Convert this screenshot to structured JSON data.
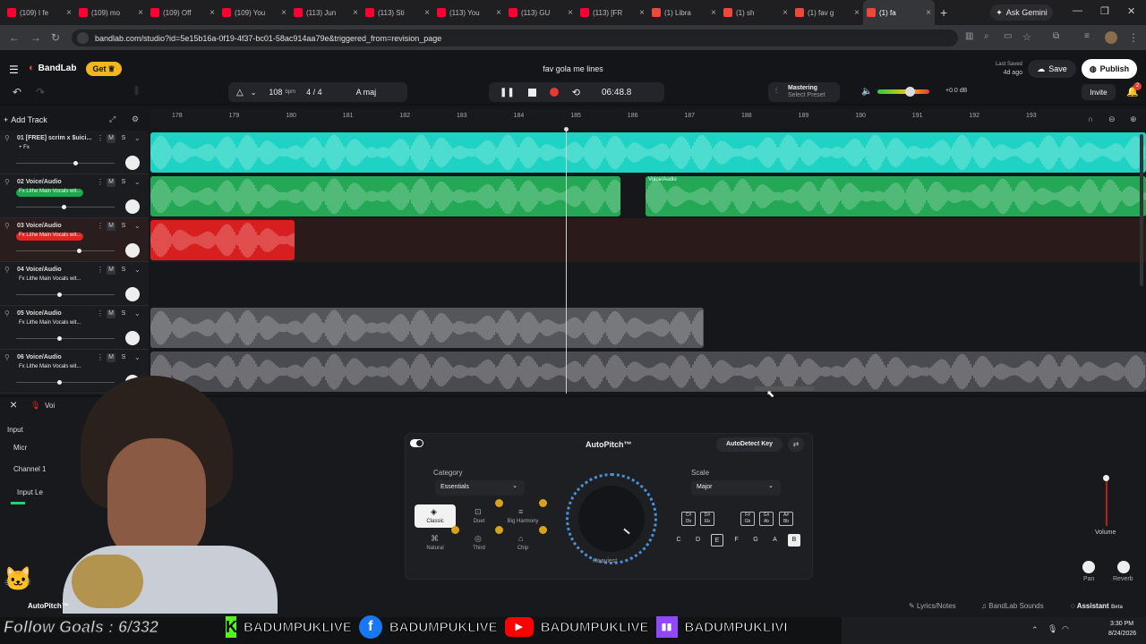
{
  "browser": {
    "tabs": [
      {
        "label": "(109) I fe",
        "color": "#ff0033"
      },
      {
        "label": "(109) mo",
        "color": "#ff0033"
      },
      {
        "label": "(109) Off",
        "color": "#ff0033"
      },
      {
        "label": "(109) You",
        "color": "#ff0033"
      },
      {
        "label": "(113) Jun",
        "color": "#ff0033"
      },
      {
        "label": "(113) Sti",
        "color": "#ff0033"
      },
      {
        "label": "(113) You",
        "color": "#ff0033"
      },
      {
        "label": "(113) GU",
        "color": "#ff0033"
      },
      {
        "label": "(113) [FR",
        "color": "#ff0033"
      },
      {
        "label": "(1) Libra",
        "color": "#f0473a"
      },
      {
        "label": "(1) sh",
        "color": "#f0473a"
      },
      {
        "label": "(1) fav g",
        "color": "#f0473a"
      },
      {
        "label": "(1) fa",
        "color": "#f0473a",
        "active": true
      }
    ],
    "new_tab": "+",
    "gemini_label": "Ask Gemini",
    "url": "bandlab.com/studio?id=5e15b16a-0f19-4f37-bc01-58ac914aa79e&triggered_from=revision_page"
  },
  "app": {
    "brand": "BandLab",
    "get_label": "Get",
    "project_title": "fav gola me lines",
    "last_saved_label": "Last Saved",
    "last_saved_value": "4d ago",
    "save_label": "Save",
    "publish_label": "Publish",
    "invite_label": "Invite",
    "notif_count": "2"
  },
  "toolbar": {
    "bpm_value": "108",
    "bpm_unit": "bpm",
    "time_sig": "4 / 4",
    "key": "A maj",
    "time": "06:48.8",
    "mastering_label": "Mastering",
    "mastering_preset": "Select Preset",
    "master_volume": "+0.0 dB",
    "master_volume_level": 0.62
  },
  "tracks_header": {
    "add_track": "Add Track"
  },
  "ruler": [
    "178",
    "179",
    "180",
    "181",
    "182",
    "183",
    "184",
    "185",
    "186",
    "187",
    "188",
    "189",
    "190",
    "191",
    "192",
    "193"
  ],
  "tracks": [
    {
      "num": "01",
      "name": "[FREE] scrim x $uici...",
      "fx": "+ Fx",
      "fx_color": "",
      "volume": 0.6,
      "color": "#1ed3c3"
    },
    {
      "num": "02",
      "name": "Voice/Audio",
      "fx": "Fx Lithe Main Vocals wit...",
      "fx_color": "#1aa84a",
      "volume": 0.48,
      "color": "#2fd86b"
    },
    {
      "num": "03",
      "name": "Voice/Audio",
      "fx": "Fx Lithe Main Vocals wit...",
      "fx_color": "#e02424",
      "volume": 0.64,
      "color": "#e02424"
    },
    {
      "num": "04",
      "name": "Voice/Audio",
      "fx": "Fx Lithe Main Vocals wit...",
      "fx_color": "",
      "volume": 0.44,
      "color": "#888"
    },
    {
      "num": "05",
      "name": "Voice/Audio",
      "fx": "Fx Lithe Main Vocals wit...",
      "fx_color": "",
      "volume": 0.44,
      "color": "#888"
    },
    {
      "num": "06",
      "name": "Voice/Audio",
      "fx": "Fx Lithe Main Vocals wit...",
      "fx_color": "",
      "volume": 0.44,
      "color": "#888"
    }
  ],
  "clip_label": "Voice/Audio",
  "bottom": {
    "close": "×",
    "voice_label": "Voi",
    "input_label": "Input",
    "mic_label": "Micr",
    "channel_label": "Channel 1",
    "input_level_label": "Input Le",
    "autopitch_tag": "AutoPitch™",
    "volume_label": "Volume",
    "pan_label": "Pan",
    "reverb_label": "Reverb",
    "lyrics_label": "Lyrics/Notes",
    "sounds_label": "BandLab Sounds",
    "assistant_label": "Assistant",
    "beta_label": "Beta"
  },
  "autopitch": {
    "title": "AutoPitch™",
    "detect_key": "AutoDetect Key",
    "category_label": "Category",
    "category_value": "Essentials",
    "scale_label": "Scale",
    "scale_value": "Major",
    "effects": [
      "Classic",
      "Duet",
      "Big Harmony",
      "Natural",
      "Third",
      "Chip"
    ],
    "knob_label": "Heaviest",
    "sharp_keys": [
      "C#\nDb",
      "D#\nEb",
      "F#\nGb",
      "G#\nAb",
      "A#\nBb"
    ],
    "natural_keys": [
      "C",
      "D",
      "E",
      "F",
      "G",
      "A",
      "B"
    ]
  },
  "stream": {
    "follow_goals": "Follow Goals : 6/332",
    "handle": "BADUMPUKLIVE",
    "handle_short": "BADUMPUKLIVI"
  },
  "taskbar": {
    "time": "3:30 PM",
    "date": "8/24/2026"
  }
}
